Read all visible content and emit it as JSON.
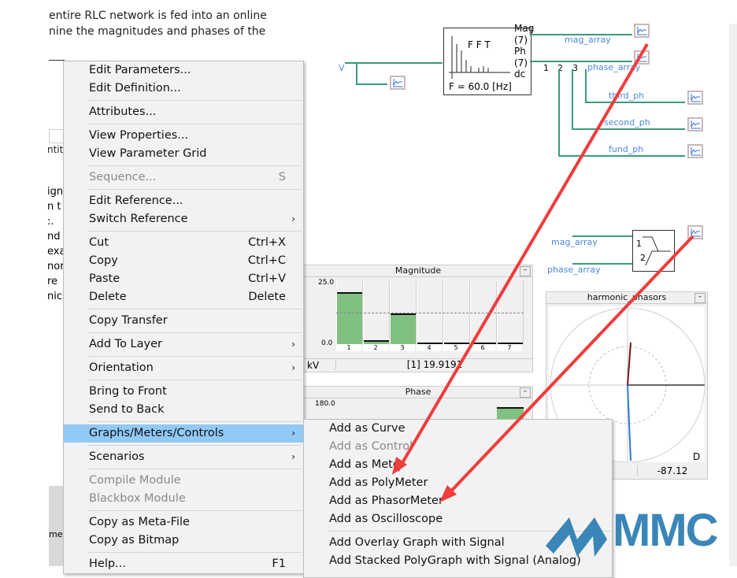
{
  "document": {
    "line1": "entire RLC network is fed into an online",
    "line2": "nine the magnitudes and phases of the",
    "fragments": [
      "ntit",
      "ign",
      "n t",
      ":.",
      "nd",
      "exa",
      "nor",
      "re",
      "nics"
    ],
    "bottom_fragment": "me"
  },
  "schematic": {
    "input_label": "V",
    "fft": {
      "title": "F F T",
      "freq": "F = 60.0 [Hz]",
      "outputs": [
        "Mag",
        "(7)",
        "Ph",
        "(7)",
        "dc"
      ]
    },
    "signals": [
      "mag_array",
      "phase_array",
      "third_ph",
      "second_ph",
      "fund_ph"
    ],
    "taps": [
      "1",
      "2",
      "3"
    ],
    "phasor_block": {
      "inputs": [
        "1",
        "2"
      ],
      "signals": [
        "mag_array",
        "phase_array"
      ]
    }
  },
  "magnitude_meter": {
    "title": "Magnitude",
    "ymax": "25.0",
    "ymin": "0.0",
    "unit": "kV",
    "readout": "[1]  19.9191",
    "channels": [
      "1",
      "2",
      "3",
      "4",
      "5",
      "6",
      "7"
    ],
    "values": [
      19.92,
      0.8,
      11.5,
      0,
      0,
      0,
      0
    ],
    "scale_max": 25,
    "reference": 12.5,
    "bar_color": "#80c080"
  },
  "phase_meter": {
    "title": "Phase",
    "ymax": "180.0"
  },
  "phasor_meter": {
    "title": "harmonic_phasors",
    "mode": "D",
    "readout": "-87.12"
  },
  "context_menu": {
    "items": [
      {
        "label": "Edit Parameters..."
      },
      {
        "label": "Edit Definition..."
      },
      {
        "sep": true
      },
      {
        "label": "Attributes..."
      },
      {
        "sep": true
      },
      {
        "label": "View Properties..."
      },
      {
        "label": "View Parameter Grid"
      },
      {
        "sep": true
      },
      {
        "label": "Sequence...",
        "shortcut": "S",
        "disabled": true
      },
      {
        "sep": true
      },
      {
        "label": "Edit Reference..."
      },
      {
        "label": "Switch Reference",
        "submenu": true
      },
      {
        "sep": true
      },
      {
        "label": "Cut",
        "shortcut": "Ctrl+X"
      },
      {
        "label": "Copy",
        "shortcut": "Ctrl+C"
      },
      {
        "label": "Paste",
        "shortcut": "Ctrl+V"
      },
      {
        "label": "Delete",
        "shortcut": "Delete"
      },
      {
        "sep": true
      },
      {
        "label": "Copy Transfer"
      },
      {
        "sep": true
      },
      {
        "label": "Add To Layer",
        "submenu": true
      },
      {
        "sep": true
      },
      {
        "label": "Orientation",
        "submenu": true
      },
      {
        "sep": true
      },
      {
        "label": "Bring to Front"
      },
      {
        "label": "Send to Back"
      },
      {
        "sep": true
      },
      {
        "label": "Graphs/Meters/Controls",
        "submenu": true,
        "highlighted": true
      },
      {
        "sep": true
      },
      {
        "label": "Scenarios",
        "submenu": true
      },
      {
        "sep": true
      },
      {
        "label": "Compile Module",
        "disabled": true
      },
      {
        "label": "Blackbox Module",
        "disabled": true
      },
      {
        "sep": true
      },
      {
        "label": "Copy as Meta-File"
      },
      {
        "label": "Copy as Bitmap"
      },
      {
        "sep": true
      },
      {
        "label": "Help...",
        "shortcut": "F1"
      }
    ]
  },
  "submenu": {
    "items": [
      {
        "label": "Add as Curve"
      },
      {
        "label": "Add as Control",
        "disabled": true
      },
      {
        "label": "Add as Meter"
      },
      {
        "label": "Add as PolyMeter"
      },
      {
        "label": "Add as PhasorMeter"
      },
      {
        "label": "Add as Oscilloscope"
      },
      {
        "sep": true
      },
      {
        "label": "Add Overlay Graph with Signal"
      },
      {
        "label": "Add Stacked PolyGraph with Signal (Analog)"
      }
    ]
  },
  "watermark": {
    "text": "MMC",
    "color": "#3a86b8"
  },
  "annotation_color": "#f03c3c"
}
